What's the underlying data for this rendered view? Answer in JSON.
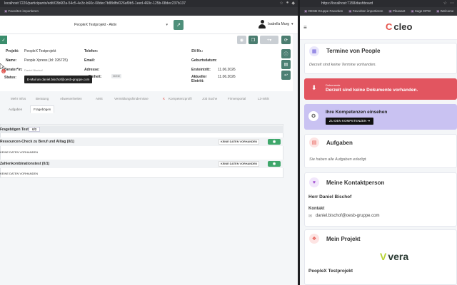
{
  "browser_left": {
    "url": "localhost:7220/participants/edit/03b6f2a-54c5-4e3c-b60c-08dec7b88dfb/026af9b5-1eed-469c-125b-08dec237b137",
    "bookmarks": [
      "Favoriten importieren"
    ]
  },
  "browser_right": {
    "url": "https://localhost:7158/dashboard",
    "bookmarks": [
      "OESB Gruppe Favoriten",
      "Favoriten importieren",
      "Pleasant",
      "Sage DPW",
      "Welcome"
    ]
  },
  "left_app": {
    "project_select": "PeopleX Testprojekt - Aktiv",
    "user_name": "Isabella Murg",
    "fields": {
      "projekt_label": "Projekt:",
      "projekt_value": "PeopleX Testprojekt",
      "name_label": "Name:",
      "name_value": "People Xpress (Id: 195725)",
      "berater_label": "Berater*in:",
      "berater_value": "Daniel Bischof",
      "status_label": "Status:",
      "telefon_label": "Telefon:",
      "email_label": "Email:",
      "adresse_label": "Adresse:",
      "einheit_label": "Einheit:",
      "einheit_badge": "NONE",
      "sv_label": "SV-Nr.:",
      "geburtsdatum_label": "Geburtsdatum:",
      "ersteintritt_label": "Ersteintritt:",
      "ersteintritt_value": "11.06.2026",
      "aktueller_label": "Aktueller Eintritt:",
      "aktueller_value": "11.06.2026"
    },
    "tooltip": "E-Mail an daniel.bischof@oesb-gruppe.com",
    "tabs_row1": [
      "Mehr Infos",
      "Beratung",
      "Abwesenheiten",
      "AMS",
      "Vermittlungshindernisse",
      "Kompetenzprofil",
      "Job Suche",
      "Firmenportal",
      "L3-Inkik"
    ],
    "tabs_row2": [
      "Aufgaben",
      "Fragebögen"
    ],
    "active_tab": "Fragebögen",
    "panel": {
      "title": "Fragebögen Test",
      "count": "0/2",
      "rows": [
        {
          "title": "Ressourcen-Check zu Beruf und Alltag (0/1)",
          "badge": "KEINE DATEN VORHANDEN",
          "sub": "KEINE DATEN VORHANDEN"
        },
        {
          "title": "Zahlenkombinationstest (0/1)",
          "badge": "KEINE DATEN VORHANDEN",
          "sub": "KEINE DATEN VORHANDEN"
        }
      ]
    }
  },
  "right_app": {
    "logo": "cleo",
    "termine_title": "Termine von People",
    "termine_text": "Derzeit sind keine Termine vorhanden.",
    "dokumente_small": "Dokumente",
    "dokumente_big": "Derzeit sind keine Dokumente vorhanden.",
    "kompetenzen_title": "Ihre Kompetenzen einsehen",
    "kompetenzen_button": "ZU DEN KOMPETENZEN",
    "aufgaben_title": "Aufgaben",
    "aufgaben_text": "Sie haben alle Aufgaben erledigt.",
    "kontakt_title": "Meine Kontaktperson",
    "kontakt_name": "Herr Daniel Bischof",
    "kontakt_label": "Kontakt",
    "kontakt_email": "daniel.bischof@oesb-gruppe.com",
    "projekt_title": "Mein Projekt",
    "vera_logo": "vera",
    "projekt_name": "PeopleX Testprojekt"
  }
}
